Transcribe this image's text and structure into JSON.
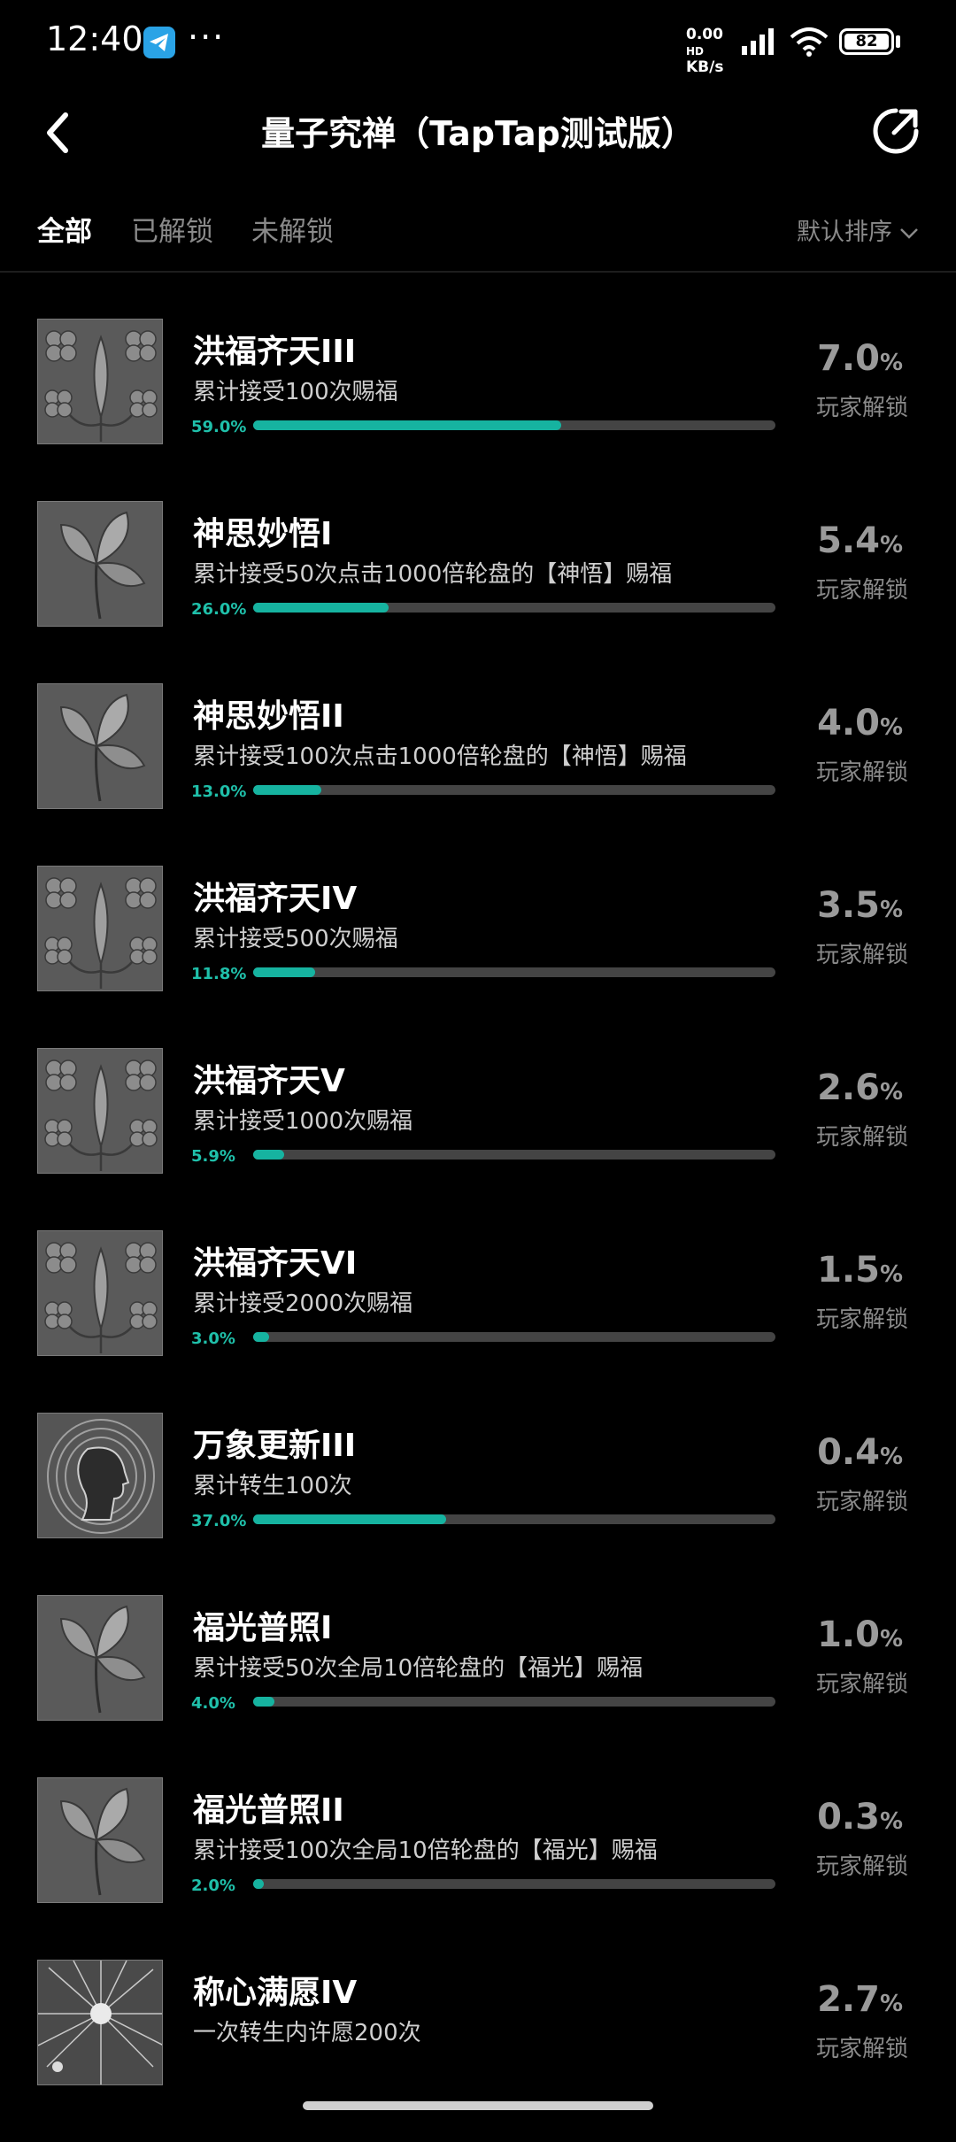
{
  "status_bar": {
    "time": "12:40",
    "more": "···",
    "net_speed": "0.00",
    "net_unit": "KB/s",
    "net_hd": "HD",
    "battery": "82"
  },
  "header": {
    "title": "量子究禅（TapTap测试版）",
    "icons": [
      "back-arrow-icon",
      "share-icon"
    ]
  },
  "tabs": [
    {
      "label": "全部",
      "active": true
    },
    {
      "label": "已解锁",
      "active": false
    },
    {
      "label": "未解锁",
      "active": false
    }
  ],
  "sort": {
    "label": "默认排序"
  },
  "colors": {
    "accent": "#16b3a0",
    "pct_text": "#1fc0aa",
    "track": "#444444"
  },
  "achievements": [
    {
      "name": "洪福齐天III",
      "desc": "累计接受100次赐福",
      "progress_label": "59.0%",
      "progress": 59.0,
      "rate": "7.0",
      "rate_unit": "%",
      "rate_label": "玩家解锁",
      "icon": "clover-pattern"
    },
    {
      "name": "神思妙悟I",
      "desc": "累计接受50次点击1000倍轮盘的【神悟】赐福",
      "progress_label": "26.0%",
      "progress": 26.0,
      "rate": "5.4",
      "rate_unit": "%",
      "rate_label": "玩家解锁",
      "icon": "leaf"
    },
    {
      "name": "神思妙悟II",
      "desc": "累计接受100次点击1000倍轮盘的【神悟】赐福",
      "progress_label": "13.0%",
      "progress": 13.0,
      "rate": "4.0",
      "rate_unit": "%",
      "rate_label": "玩家解锁",
      "icon": "leaf"
    },
    {
      "name": "洪福齐天IV",
      "desc": "累计接受500次赐福",
      "progress_label": "11.8%",
      "progress": 11.8,
      "rate": "3.5",
      "rate_unit": "%",
      "rate_label": "玩家解锁",
      "icon": "clover-pattern"
    },
    {
      "name": "洪福齐天V",
      "desc": "累计接受1000次赐福",
      "progress_label": "5.9%",
      "progress": 5.9,
      "rate": "2.6",
      "rate_unit": "%",
      "rate_label": "玩家解锁",
      "icon": "clover-pattern"
    },
    {
      "name": "洪福齐天VI",
      "desc": "累计接受2000次赐福",
      "progress_label": "3.0%",
      "progress": 3.0,
      "rate": "1.5",
      "rate_unit": "%",
      "rate_label": "玩家解锁",
      "icon": "clover-pattern"
    },
    {
      "name": "万象更新III",
      "desc": "累计转生100次",
      "progress_label": "37.0%",
      "progress": 37.0,
      "rate": "0.4",
      "rate_unit": "%",
      "rate_label": "玩家解锁",
      "icon": "head-profile"
    },
    {
      "name": "福光普照I",
      "desc": "累计接受50次全局10倍轮盘的【福光】赐福",
      "progress_label": "4.0%",
      "progress": 4.0,
      "rate": "1.0",
      "rate_unit": "%",
      "rate_label": "玩家解锁",
      "icon": "leaf"
    },
    {
      "name": "福光普照II",
      "desc": "累计接受100次全局10倍轮盘的【福光】赐福",
      "progress_label": "2.0%",
      "progress": 2.0,
      "rate": "0.3",
      "rate_unit": "%",
      "rate_label": "玩家解锁",
      "icon": "leaf"
    },
    {
      "name": "称心满愿IV",
      "desc": "一次转生内许愿200次",
      "progress_label": "",
      "progress": null,
      "rate": "2.7",
      "rate_unit": "%",
      "rate_label": "玩家解锁",
      "icon": "starburst"
    }
  ]
}
